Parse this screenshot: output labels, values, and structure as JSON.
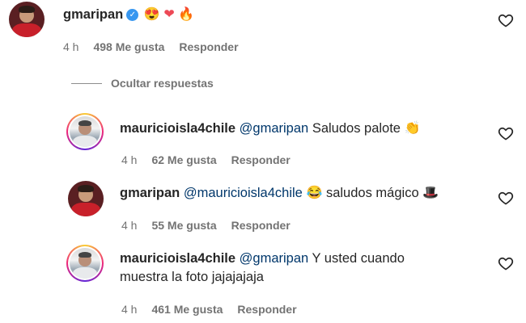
{
  "comments": [
    {
      "username": "gmaripan",
      "mention": "",
      "text": "",
      "emojis": [
        "😍",
        "❤",
        "🔥"
      ],
      "time": "4 h",
      "likes": "498 Me gusta",
      "reply": "Responder",
      "verified": true
    },
    {
      "username": "mauricioisla4chile",
      "mention": "@gmaripan",
      "text": "Saludos palote",
      "emoji": "👏",
      "time": "4 h",
      "likes": "62 Me gusta",
      "reply": "Responder"
    },
    {
      "username": "gmaripan",
      "mention": "@mauricioisla4chile",
      "emoji": "😂",
      "text": "saludos mágico",
      "emoji2": "🎩",
      "time": "4 h",
      "likes": "55 Me gusta",
      "reply": "Responder"
    },
    {
      "username": "mauricioisla4chile",
      "mention": "@gmaripan",
      "text": "Y usted cuando",
      "text2": "muestra la foto jajajajaja",
      "time": "4 h",
      "likes": "461 Me gusta",
      "reply": "Responder"
    }
  ],
  "hide_replies": "Ocultar respuestas",
  "icons": {
    "like": "heart-outline-icon",
    "verified": "verified-badge-icon"
  },
  "colors": {
    "mention": "#00376b",
    "meta": "#737373",
    "verified": "#3897f0"
  }
}
